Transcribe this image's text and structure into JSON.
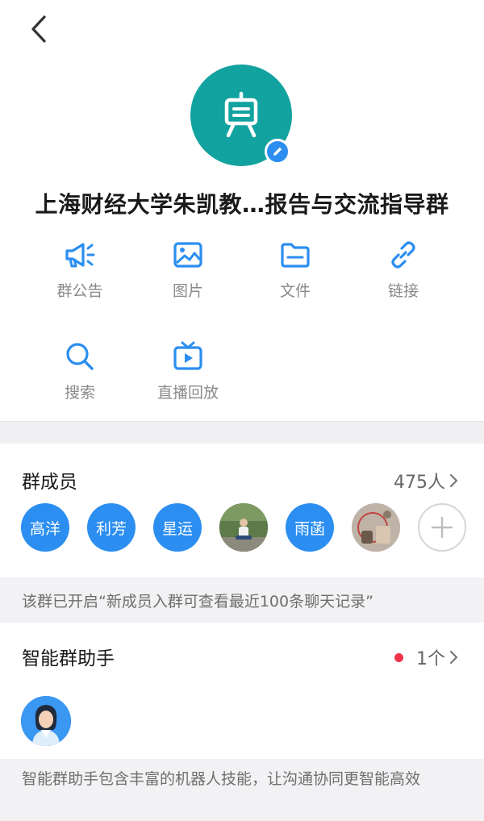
{
  "header": {
    "back_icon": "chevron-left-icon",
    "avatar_icon": "presentation-board-icon",
    "avatar_color": "#12a29f",
    "edit_icon": "pencil-icon",
    "group_name": "上海财经大学朱凯教…报告与交流指导群"
  },
  "tools": [
    {
      "icon": "megaphone-icon",
      "label": "群公告"
    },
    {
      "icon": "image-icon",
      "label": "图片"
    },
    {
      "icon": "folder-icon",
      "label": "文件"
    },
    {
      "icon": "link-icon",
      "label": "链接"
    },
    {
      "icon": "search-icon",
      "label": "搜索"
    },
    {
      "icon": "tv-play-icon",
      "label": "直播回放"
    }
  ],
  "members_section": {
    "title": "群成员",
    "count": "475人",
    "members": [
      {
        "name": "高洋"
      },
      {
        "name": "利芳"
      },
      {
        "name": "星运"
      },
      {
        "name": ""
      },
      {
        "name": "雨菡"
      },
      {
        "name": ""
      }
    ],
    "add_icon": "plus-icon"
  },
  "history_notice": "该群已开启“新成员入群可查看最近100条聊天记录”",
  "assistant_section": {
    "title": "智能群助手",
    "count": "1个",
    "description": "智能群助手包含丰富的机器人技能，让沟通协同更智能高效"
  },
  "colors": {
    "accent": "#2b8ef0",
    "badge_red": "#f0334b"
  }
}
